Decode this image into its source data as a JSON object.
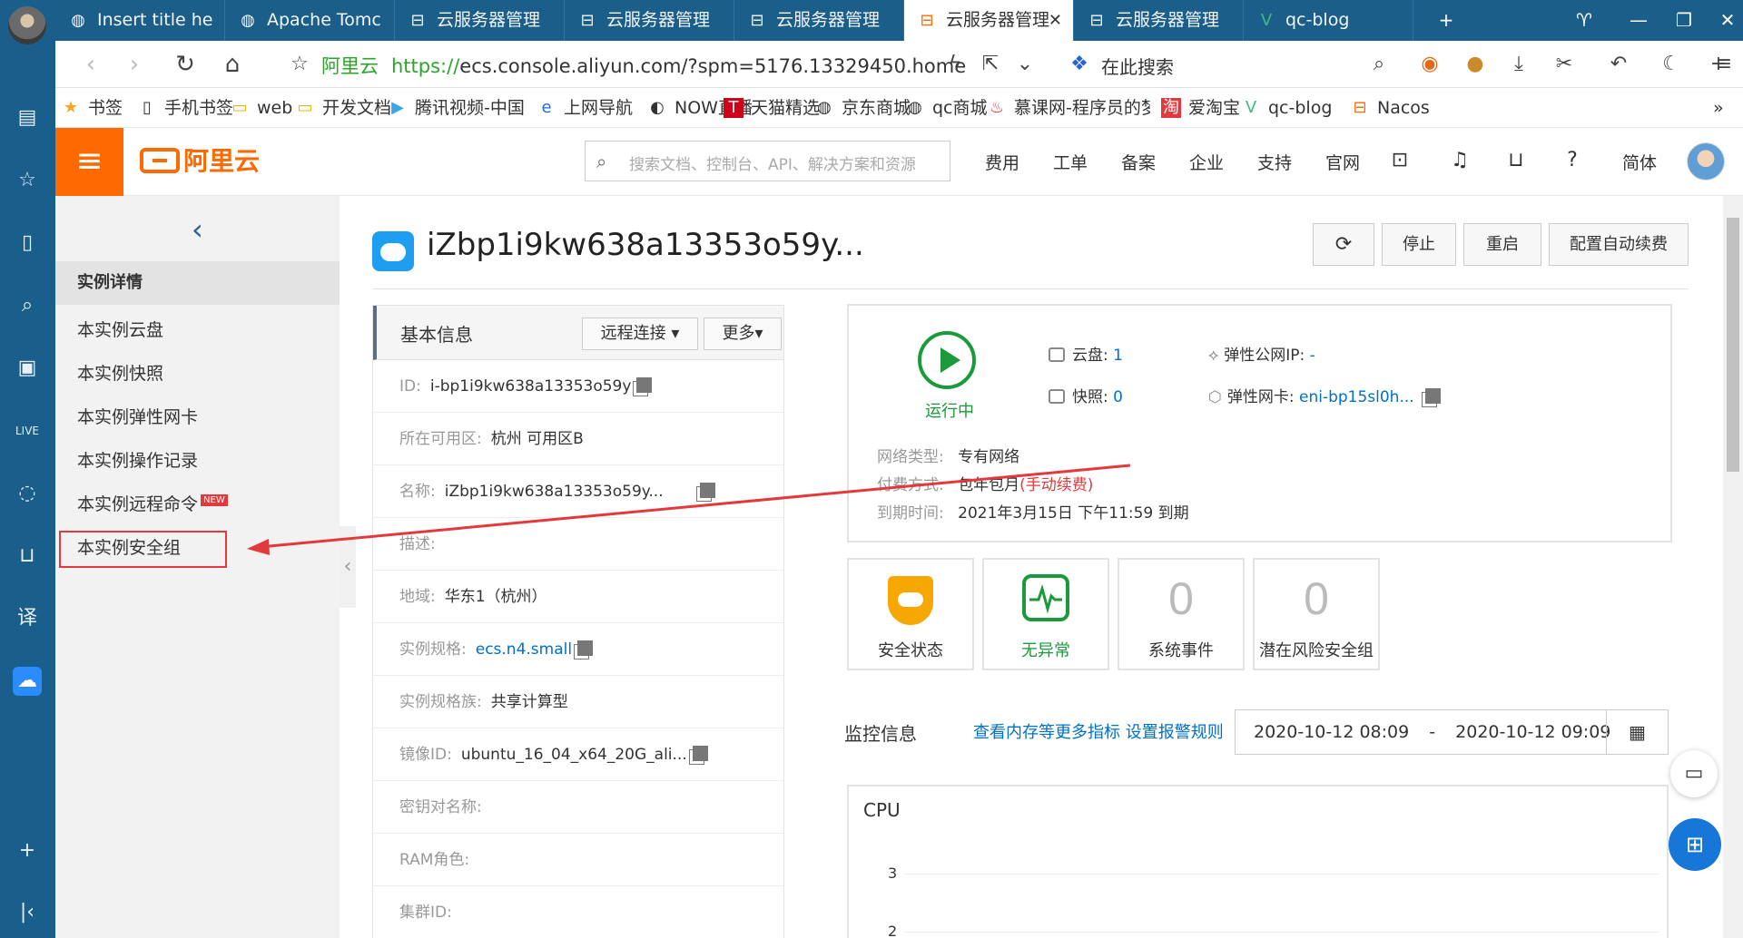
{
  "browser": {
    "tabs": [
      {
        "title": "Insert title he",
        "icon": "globe-icon"
      },
      {
        "title": "Apache Tomc",
        "icon": "globe-icon"
      },
      {
        "title": "云服务器管理",
        "icon": "aliyun-icon"
      },
      {
        "title": "云服务器管理",
        "icon": "aliyun-icon"
      },
      {
        "title": "云服务器管理",
        "icon": "aliyun-icon"
      },
      {
        "title": "云服务器管理",
        "icon": "aliyun-icon",
        "active": true
      },
      {
        "title": "云服务器管理",
        "icon": "aliyun-icon"
      },
      {
        "title": "qc-blog",
        "icon": "vue-icon"
      }
    ],
    "url_site": "阿里云",
    "url_scheme": "https://",
    "url_rest": "ecs.console.aliyun.com/?spm=5176.13329450.home",
    "search_text": "在此搜索",
    "bookmarks": [
      "书签",
      "手机书签",
      "web",
      "开发文档",
      "腾讯视频-中国领先",
      "上网导航",
      "NOW直播",
      "天猫精选",
      "京东商城",
      "qc商城",
      "慕课网-程序员的梦",
      "爱淘宝",
      "qc-blog",
      "Nacos"
    ]
  },
  "header": {
    "logo_text": "阿里云",
    "search_placeholder": "搜索文档、控制台、API、解决方案和资源",
    "nav": [
      "费用",
      "工单",
      "备案",
      "企业",
      "支持",
      "官网"
    ],
    "lang": "简体"
  },
  "sidebar": {
    "title": "实例详情",
    "items": [
      {
        "label": "本实例云盘"
      },
      {
        "label": "本实例快照"
      },
      {
        "label": "本实例弹性网卡"
      },
      {
        "label": "本实例操作记录"
      },
      {
        "label": "本实例远程命令",
        "badge": "NEW"
      },
      {
        "label": "本实例安全组",
        "highlighted": true
      }
    ]
  },
  "instance": {
    "title": "iZbp1i9kw638a13353o59y...",
    "actions": [
      "停止",
      "重启",
      "配置自动续费"
    ]
  },
  "basic_info": {
    "title": "基本信息",
    "remote_btn": "远程连接",
    "more_btn": "更多",
    "rows": [
      {
        "k": "ID:",
        "v": "i-bp1i9kw638a13353o59y",
        "copy": true
      },
      {
        "k": "所在可用区:",
        "v": "杭州 可用区B"
      },
      {
        "k": "名称:",
        "v": "iZbp1i9kw638a13353o59y...",
        "copy": true
      },
      {
        "k": "描述:",
        "v": ""
      },
      {
        "k": "地域:",
        "v": "华东1（杭州）"
      },
      {
        "k": "实例规格:",
        "v": "ecs.n4.small",
        "link": true,
        "copy": true
      },
      {
        "k": "实例规格族:",
        "v": "共享计算型"
      },
      {
        "k": "镜像ID:",
        "v": "ubuntu_16_04_x64_20G_ali...",
        "copy": true
      },
      {
        "k": "密钥对名称:",
        "v": ""
      },
      {
        "k": "RAM角色:",
        "v": ""
      },
      {
        "k": "集群ID:",
        "v": ""
      }
    ]
  },
  "status": {
    "running": "运行中",
    "disk_label": "云盘:",
    "disk_value": "1",
    "snapshot_label": "快照:",
    "snapshot_value": "0",
    "eip_label": "弹性公网IP:",
    "eip_value": "-",
    "eni_label": "弹性网卡:",
    "eni_value": "eni-bp15sl0h...",
    "network_label": "网络类型:",
    "network_value": "专有网络",
    "billing_label": "付费方式:",
    "billing_value": "包年包月",
    "billing_note": "(手动续费)",
    "expire_label": "到期时间:",
    "expire_value": "2021年3月15日 下午11:59 到期"
  },
  "cards": [
    {
      "label": "安全状态",
      "icon": "shield-icon"
    },
    {
      "label": "无异常",
      "icon": "pulse-icon",
      "green": true
    },
    {
      "label": "系统事件",
      "value": "0"
    },
    {
      "label": "潜在风险安全组",
      "value": "0"
    }
  ],
  "monitor": {
    "title": "监控信息",
    "links": "查看内存等更多指标 设置报警规则",
    "date_from": "2020-10-12 08:09",
    "date_sep": "-",
    "date_to": "2020-10-12 09:09",
    "chart_title": "CPU",
    "y_ticks": [
      "3",
      "2"
    ]
  },
  "colors": {
    "accent": "#ff6a00",
    "link": "#0070cc",
    "ok": "#1a9a3a",
    "annotation": "#e4393c"
  }
}
